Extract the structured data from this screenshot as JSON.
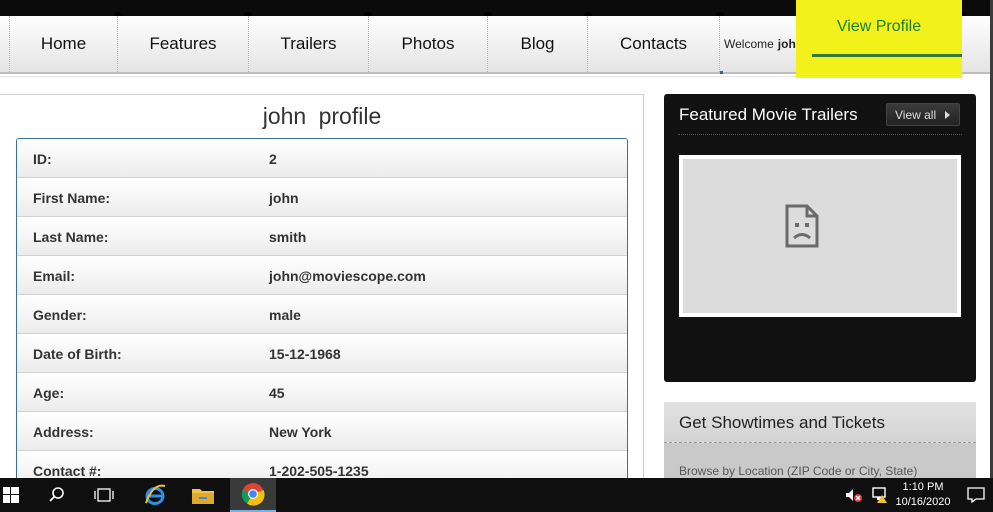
{
  "nav": {
    "items": [
      "Home",
      "Features",
      "Trailers",
      "Photos",
      "Blog",
      "Contacts"
    ],
    "welcome_text": "Welcome",
    "welcome_user": "john,",
    "view_profile": "View Profile"
  },
  "profile": {
    "title": "john  profile",
    "rows": [
      {
        "label": "ID:",
        "value": "2"
      },
      {
        "label": "First Name:",
        "value": "john"
      },
      {
        "label": "Last Name:",
        "value": "smith"
      },
      {
        "label": "Email:",
        "value": "john@moviescope.com"
      },
      {
        "label": "Gender:",
        "value": "male"
      },
      {
        "label": "Date of Birth:",
        "value": "15-12-1968"
      },
      {
        "label": "Age:",
        "value": "45"
      },
      {
        "label": "Address:",
        "value": "New York"
      },
      {
        "label": "Contact #:",
        "value": "1-202-505-1235"
      }
    ]
  },
  "trailers": {
    "title": "Featured Movie Trailers",
    "view_all": "View all"
  },
  "showtimes": {
    "title": "Get Showtimes and Tickets",
    "browse_text": "Browse by Location (ZIP Code or City, State)"
  },
  "taskbar": {
    "time": "1:10 PM",
    "date": "10/16/2020"
  },
  "colors": {
    "highlight": "#f2f21a",
    "active_link": "#1b7d2e",
    "table_border": "#3a6f96"
  }
}
